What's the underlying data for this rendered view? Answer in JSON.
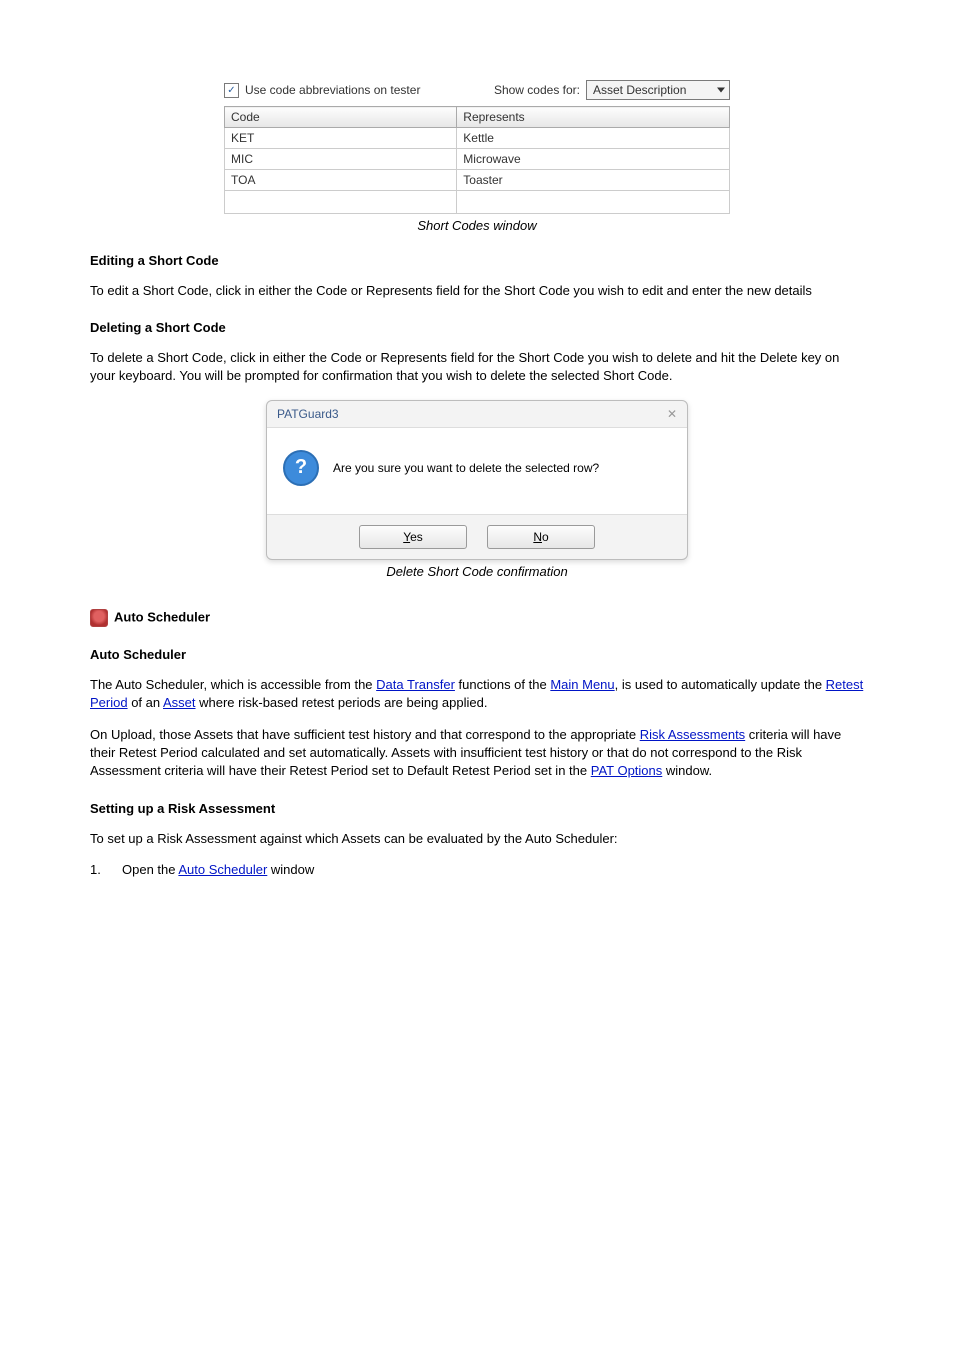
{
  "codes_panel": {
    "checkbox_label": "Use code abbreviations on tester",
    "checkbox_checked_glyph": "✓",
    "show_codes_label": "Show codes for:",
    "dropdown_value": "Asset Description",
    "columns": {
      "code": "Code",
      "represents": "Represents"
    },
    "rows": [
      {
        "code": "KET",
        "represents": "Kettle"
      },
      {
        "code": "MIC",
        "represents": "Microwave"
      },
      {
        "code": "TOA",
        "represents": "Toaster"
      }
    ]
  },
  "caption1": "Short Codes window",
  "edit_heading": "Editing a Short Code",
  "edit_para": "To edit a Short Code, click in either the Code or Represents field for the Short Code you wish to edit and enter the new details",
  "delete_heading": "Deleting a Short Code",
  "delete_para": "To delete a Short Code, click in either the Code or Represents field for the Short Code you wish to delete and hit the Delete key on your keyboard. You will be prompted for confirmation that you wish to delete the selected Short Code.",
  "dialog": {
    "title": "PATGuard3",
    "close_glyph": "✕",
    "question_glyph": "?",
    "message": "Are you sure you want to delete the selected row?",
    "yes": "Yes",
    "no": "No"
  },
  "caption2": "Delete Short Code confirmation",
  "auto_sched": {
    "heading": "Auto Scheduler",
    "subhead": "Auto Scheduler",
    "intro_pre": "The Auto Scheduler, which is accessible from the ",
    "intro_link1": "Data Transfer",
    "intro_mid": " functions of the ",
    "intro_link2": "Main Menu",
    "intro_end": ", is used to automatically update the ",
    "intro_link3": "Retest Period",
    "intro_pre2": " of an ",
    "intro_link4": "Asset",
    "intro_tail": " where risk-based retest periods are being applied.",
    "para2_pre": "On Upload, those Assets that have sufficient test history and that correspond to the appropriate ",
    "para2_link1": "Risk Assessments",
    "para2_mid": " criteria will have their Retest Period calculated and set automatically. Assets with insufficient test history or that do not correspond to the Risk Assessment criteria will have their Retest Period set to Default Retest Period set in the ",
    "para2_link2": "PAT Options",
    "para2_end": " window.",
    "risk_heading": "Setting up a Risk Assessment",
    "risk_para": "To set up a Risk Assessment against which Assets can be evaluated by the Auto Scheduler:",
    "step1": {
      "num": "1.",
      "text_pre": "Open the ",
      "link": "Auto Scheduler",
      "text_post": " window"
    }
  }
}
